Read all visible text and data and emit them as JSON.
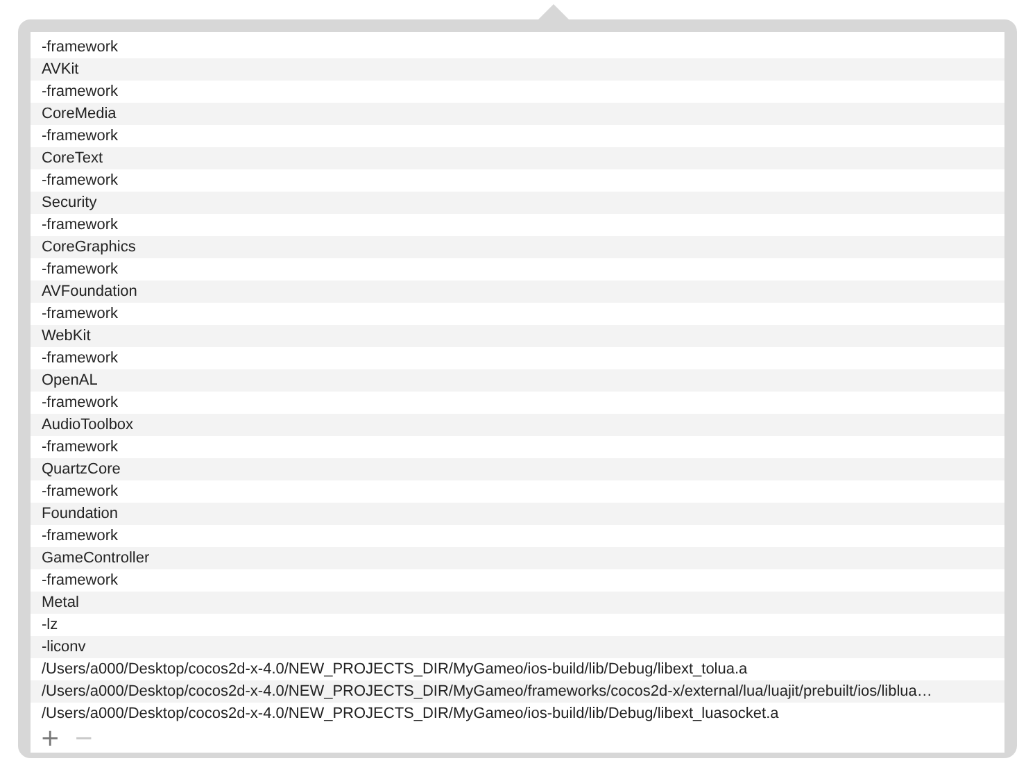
{
  "list": {
    "rows": [
      "-framework",
      "AVKit",
      "-framework",
      "CoreMedia",
      "-framework",
      "CoreText",
      "-framework",
      "Security",
      "-framework",
      "CoreGraphics",
      "-framework",
      "AVFoundation",
      "-framework",
      "WebKit",
      "-framework",
      "OpenAL",
      "-framework",
      "AudioToolbox",
      "-framework",
      "QuartzCore",
      "-framework",
      "Foundation",
      "-framework",
      "GameController",
      "-framework",
      "Metal",
      "-lz",
      "-liconv",
      "/Users/a000/Desktop/cocos2d-x-4.0/NEW_PROJECTS_DIR/MyGameo/ios-build/lib/Debug/libext_tolua.a",
      "/Users/a000/Desktop/cocos2d-x-4.0/NEW_PROJECTS_DIR/MyGameo/frameworks/cocos2d-x/external/lua/luajit/prebuilt/ios/liblua…",
      "/Users/a000/Desktop/cocos2d-x-4.0/NEW_PROJECTS_DIR/MyGameo/ios-build/lib/Debug/libext_luasocket.a"
    ]
  },
  "buttons": [
    {
      "label": "+",
      "disabled": false
    },
    {
      "label": "−",
      "disabled": true
    }
  ]
}
